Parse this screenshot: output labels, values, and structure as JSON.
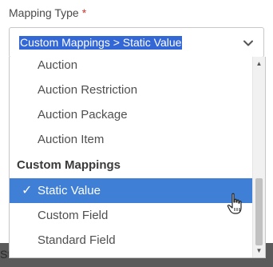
{
  "field": {
    "label": "Mapping Type",
    "required_marker": "*",
    "selected_value": "Custom Mappings > Static Value"
  },
  "dropdown": {
    "options": [
      {
        "label": "Auction",
        "type": "option",
        "selected": false
      },
      {
        "label": "Auction Restriction",
        "type": "option",
        "selected": false
      },
      {
        "label": "Auction Package",
        "type": "option",
        "selected": false
      },
      {
        "label": "Auction Item",
        "type": "option",
        "selected": false
      },
      {
        "label": "Custom Mappings",
        "type": "group",
        "selected": false
      },
      {
        "label": "Static Value",
        "type": "option",
        "selected": true
      },
      {
        "label": "Custom Field",
        "type": "option",
        "selected": false
      },
      {
        "label": "Standard Field",
        "type": "option",
        "selected": false
      }
    ],
    "check_glyph": "✓"
  },
  "page_fragment": "St",
  "colors": {
    "selection": "#3f7fd6",
    "text_highlight": "#3367d6",
    "required": "#d0342c"
  },
  "icons": {
    "chevron": "chevron-down-icon",
    "check": "checkmark-icon",
    "cursor": "hand-pointer-cursor"
  }
}
